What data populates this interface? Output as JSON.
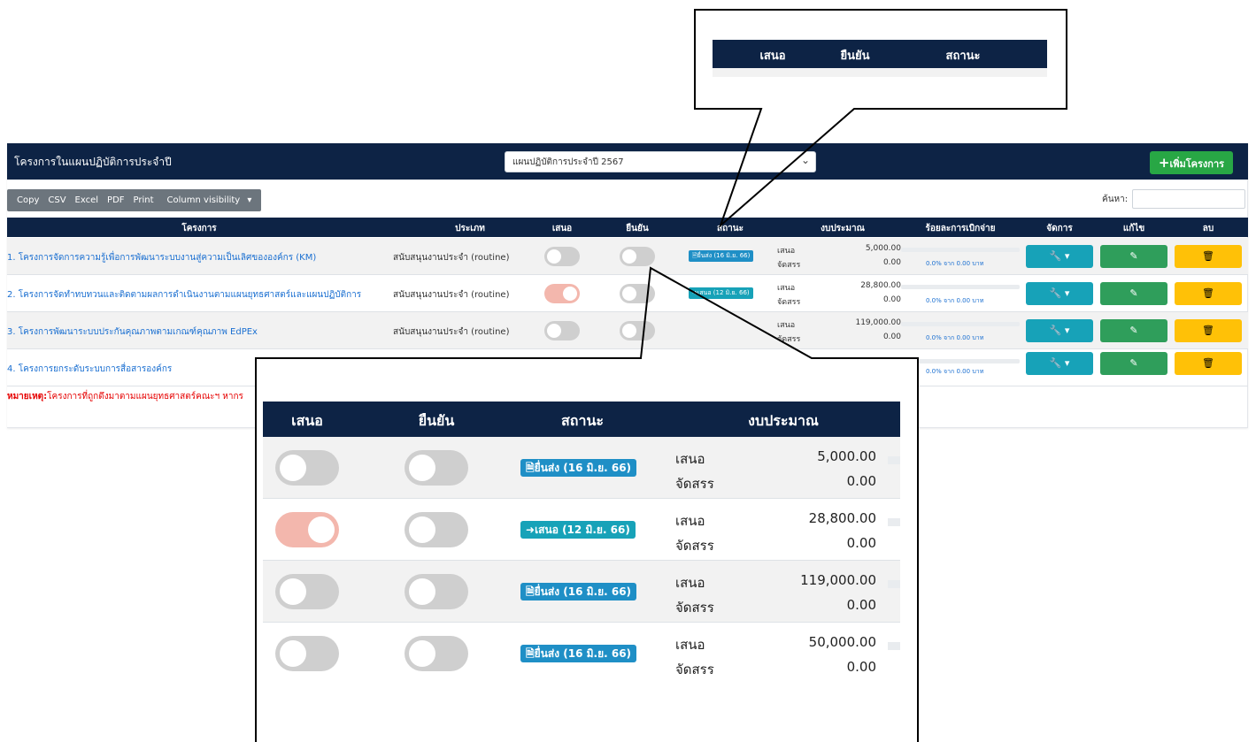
{
  "panel": {
    "title": "โครงการในแผนปฏิบัติการประจำปี",
    "plan_select": {
      "selected": "แผนปฏิบัติการประจำปี 2567"
    },
    "add_button": "เพิ่มโครงการ",
    "toolbar": {
      "copy": "Copy",
      "csv": "CSV",
      "excel": "Excel",
      "pdf": "PDF",
      "print": "Print",
      "column_visibility": "Column visibility"
    },
    "search_label": "ค้นหา:"
  },
  "table": {
    "headers": {
      "project": "โครงการ",
      "type": "ประเภท",
      "propose": "เสนอ",
      "confirm": "ยืนยัน",
      "status": "สถานะ",
      "budget": "งบประมาณ",
      "disbursement": "ร้อยละการเบิกจ่าย",
      "manage": "จัดการ",
      "edit": "แก้ไข",
      "delete": "ลบ"
    },
    "rows": [
      {
        "project": "1. โครงการจัดการความรู้เพื่อการพัฒนาระบบงานสู่ความเป็นเลิศขององค์กร (KM)",
        "type": "สนับสนุนงานประจำ (routine)",
        "status": "ยื่นส่ง (16 มิ.ย. 66)",
        "budget_label": "เสนอ",
        "budget_value": "5,000.00",
        "alloc_label": "จัดสรร",
        "alloc_value": "0.00",
        "disbursement": "0.0% จาก 0.00 บาท",
        "proposed": false,
        "confirmed": false
      },
      {
        "project": "2. โครงการจัดทำทบทวนและติดตามผลการดำเนินงานตามแผนยุทธศาสตร์และแผนปฏิบัติการ",
        "type": "สนับสนุนงานประจำ (routine)",
        "status": "เสนอ (12 มิ.ย. 66)",
        "budget_label": "เสนอ",
        "budget_value": "28,800.00",
        "alloc_label": "จัดสรร",
        "alloc_value": "0.00",
        "disbursement": "0.0% จาก 0.00 บาท",
        "proposed": true,
        "confirmed": false
      },
      {
        "project": "3. โครงการพัฒนาระบบประกันคุณภาพตามเกณฑ์คุณภาพ EdPEx",
        "type": "สนับสนุนงานประจำ (routine)",
        "status": "ยื่นส่ง (16 มิ.ย. 66)",
        "budget_label": "เสนอ",
        "budget_value": "119,000.00",
        "alloc_label": "จัดสรร",
        "alloc_value": "0.00",
        "disbursement": "0.0% จาก 0.00 บาท",
        "proposed": false,
        "confirmed": false
      },
      {
        "project": "4. โครงการยกระดับระบบการสื่อสารองค์กร",
        "type": "",
        "status": "ยื่นส่ง (16 มิ.ย. 66)",
        "budget_label": "เสนอ",
        "budget_value": "50,000.00",
        "alloc_label": "จัดสรร",
        "alloc_value": "0.00",
        "disbursement": "0.0% จาก 0.00 บาท",
        "proposed": false,
        "confirmed": false
      }
    ],
    "note_label": "หมายเหตุ:",
    "note_text": "โครงการที่ถูกดึงมาตามแผนยุทธศาสตร์คณะฯ หากร"
  },
  "zoom_top": {
    "headers": {
      "propose": "เสนอ",
      "confirm": "ยืนยัน",
      "status": "สถานะ"
    }
  },
  "zoom_bottom": {
    "headers": {
      "propose": "เสนอ",
      "confirm": "ยืนยัน",
      "status": "สถานะ",
      "budget": "งบประมาณ"
    }
  },
  "colors": {
    "navy": "#0d2345",
    "add_green": "#28a745",
    "info": "#17a2b8",
    "success": "#2f9e5b",
    "warning": "#ffc107",
    "toggle_off": "#cfcfcf",
    "toggle_on": "#f3b7ad",
    "link_blue": "#1a6fd1",
    "note_red": "#e60000"
  },
  "icons": {
    "add": "plus-icon",
    "manage": "wrench-icon",
    "edit": "pencil-icon",
    "delete": "trash-icon",
    "submitted": "document-icon",
    "proposed": "sign-in-icon",
    "dropdown": "chevron-down-icon"
  }
}
